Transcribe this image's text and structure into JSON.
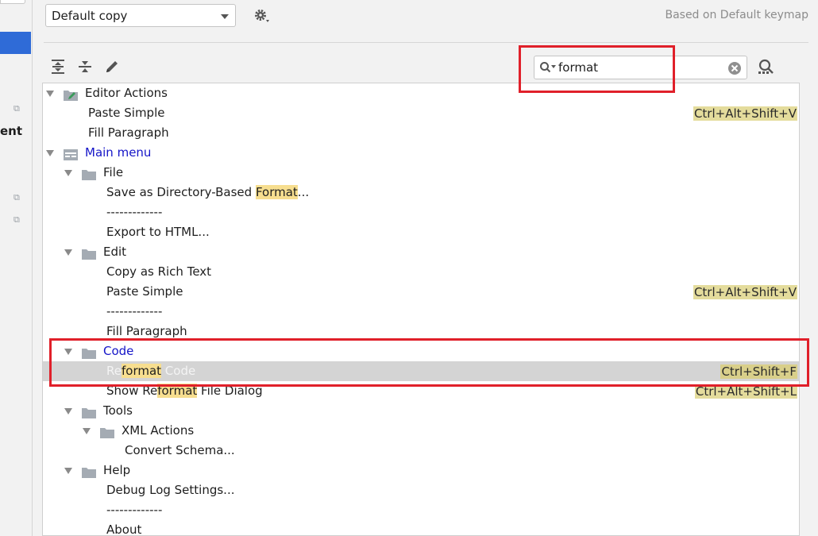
{
  "left_panel": {
    "partial_label": "ent"
  },
  "toolbar": {
    "keymap_value": "Default copy",
    "based_on": "Based on Default keymap"
  },
  "search": {
    "value": "format"
  },
  "tree": {
    "rows": [
      {
        "label": "Editor Actions"
      },
      {
        "label": "Paste Simple",
        "shortcut": "Ctrl+Alt+Shift+V"
      },
      {
        "label": "Fill Paragraph"
      },
      {
        "label": "Main menu"
      },
      {
        "label": "File"
      },
      {
        "label_pre": "Save as Directory-Based ",
        "label_hl": "Format",
        "label_post": "..."
      },
      {
        "label": "-------------"
      },
      {
        "label": "Export to HTML..."
      },
      {
        "label": "Edit"
      },
      {
        "label": "Copy as Rich Text"
      },
      {
        "label": "Paste Simple",
        "shortcut": "Ctrl+Alt+Shift+V"
      },
      {
        "label": "-------------"
      },
      {
        "label": "Fill Paragraph"
      },
      {
        "label": "Code"
      },
      {
        "label_pre": "Re",
        "label_hl": "format",
        "label_post": " Code",
        "shortcut": "Ctrl+Shift+F"
      },
      {
        "label_pre": "Show Re",
        "label_hl": "format",
        "label_post": " File Dialog",
        "shortcut": "Ctrl+Alt+Shift+L"
      },
      {
        "label": "Tools"
      },
      {
        "label": "XML Actions"
      },
      {
        "label": "Convert Schema..."
      },
      {
        "label": "Help"
      },
      {
        "label": "Debug Log Settings..."
      },
      {
        "label": "-------------"
      },
      {
        "label": "About"
      }
    ]
  }
}
